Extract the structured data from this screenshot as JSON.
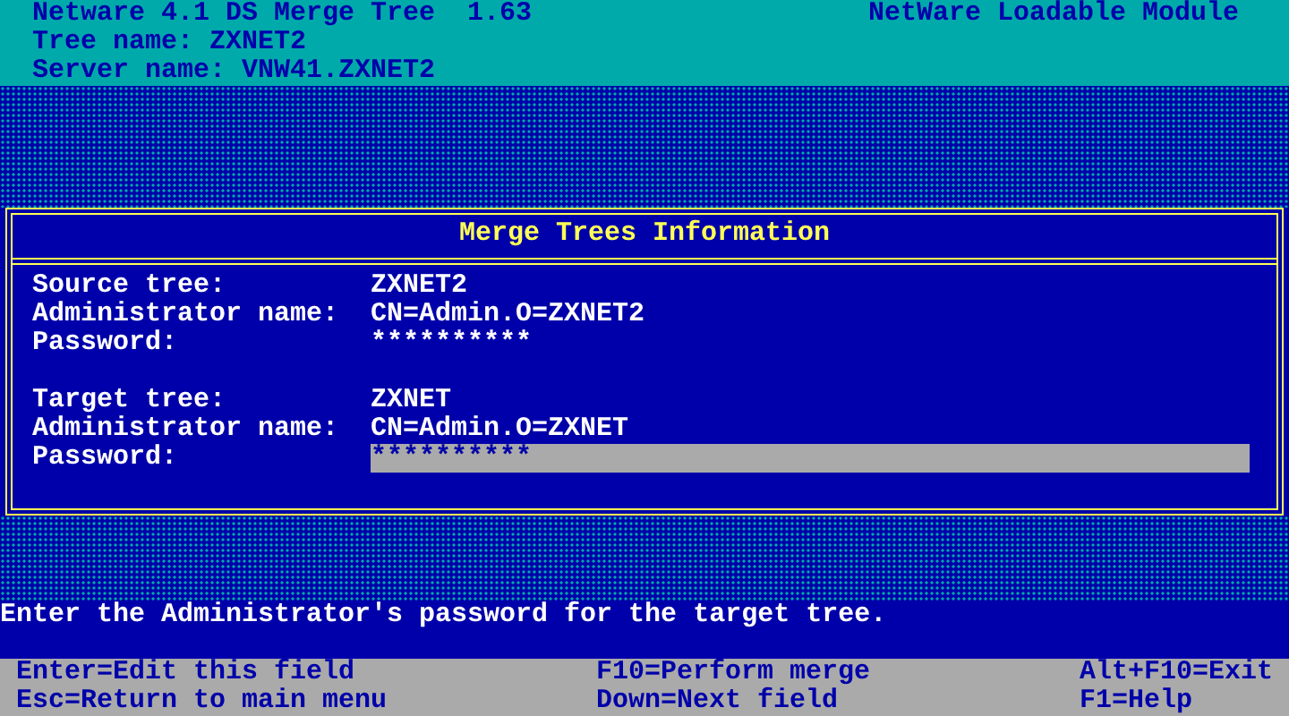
{
  "header": {
    "title": "Netware 4.1 DS Merge Tree  1.63",
    "module": "NetWare Loadable Module",
    "lines": [
      "Tree name: ZXNET2",
      "Server name: VNW41.ZXNET2"
    ]
  },
  "dialog": {
    "title": "Merge Trees Information",
    "groups": [
      {
        "fields": [
          {
            "label": "Source tree:",
            "value": "ZXNET2",
            "selected": false
          },
          {
            "label": "Administrator name:",
            "value": "CN=Admin.O=ZXNET2",
            "selected": false
          },
          {
            "label": "Password:",
            "value": "**********",
            "selected": false
          }
        ]
      },
      {
        "fields": [
          {
            "label": "Target tree:",
            "value": "ZXNET",
            "selected": false
          },
          {
            "label": "Administrator name:",
            "value": "CN=Admin.O=ZXNET",
            "selected": false
          },
          {
            "label": "Password:",
            "value": "**********",
            "selected": true
          }
        ]
      }
    ]
  },
  "message": "Enter the Administrator's password for the target tree.",
  "help_keys": [
    "Enter=Edit this field",
    "F10=Perform merge",
    "Alt+F10=Exit",
    "Esc=Return to main menu",
    "Down=Next field",
    "F1=Help"
  ]
}
